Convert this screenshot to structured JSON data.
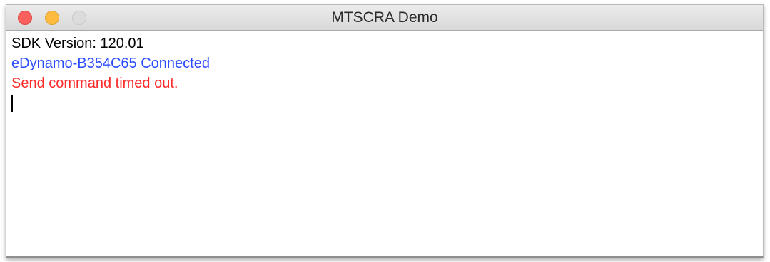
{
  "window": {
    "title": "MTSCRA Demo"
  },
  "log": {
    "lines": [
      {
        "text": "SDK Version: 120.01",
        "color": "#000000"
      },
      {
        "text": "eDynamo-B354C65 Connected",
        "color": "#2a4bff"
      },
      {
        "text": "Send command timed out.",
        "color": "#ff2a2a"
      }
    ]
  },
  "colors": {
    "close": "#fc605c",
    "minimize": "#fdbc40",
    "zoom_inactive": "#dcdcdc"
  }
}
